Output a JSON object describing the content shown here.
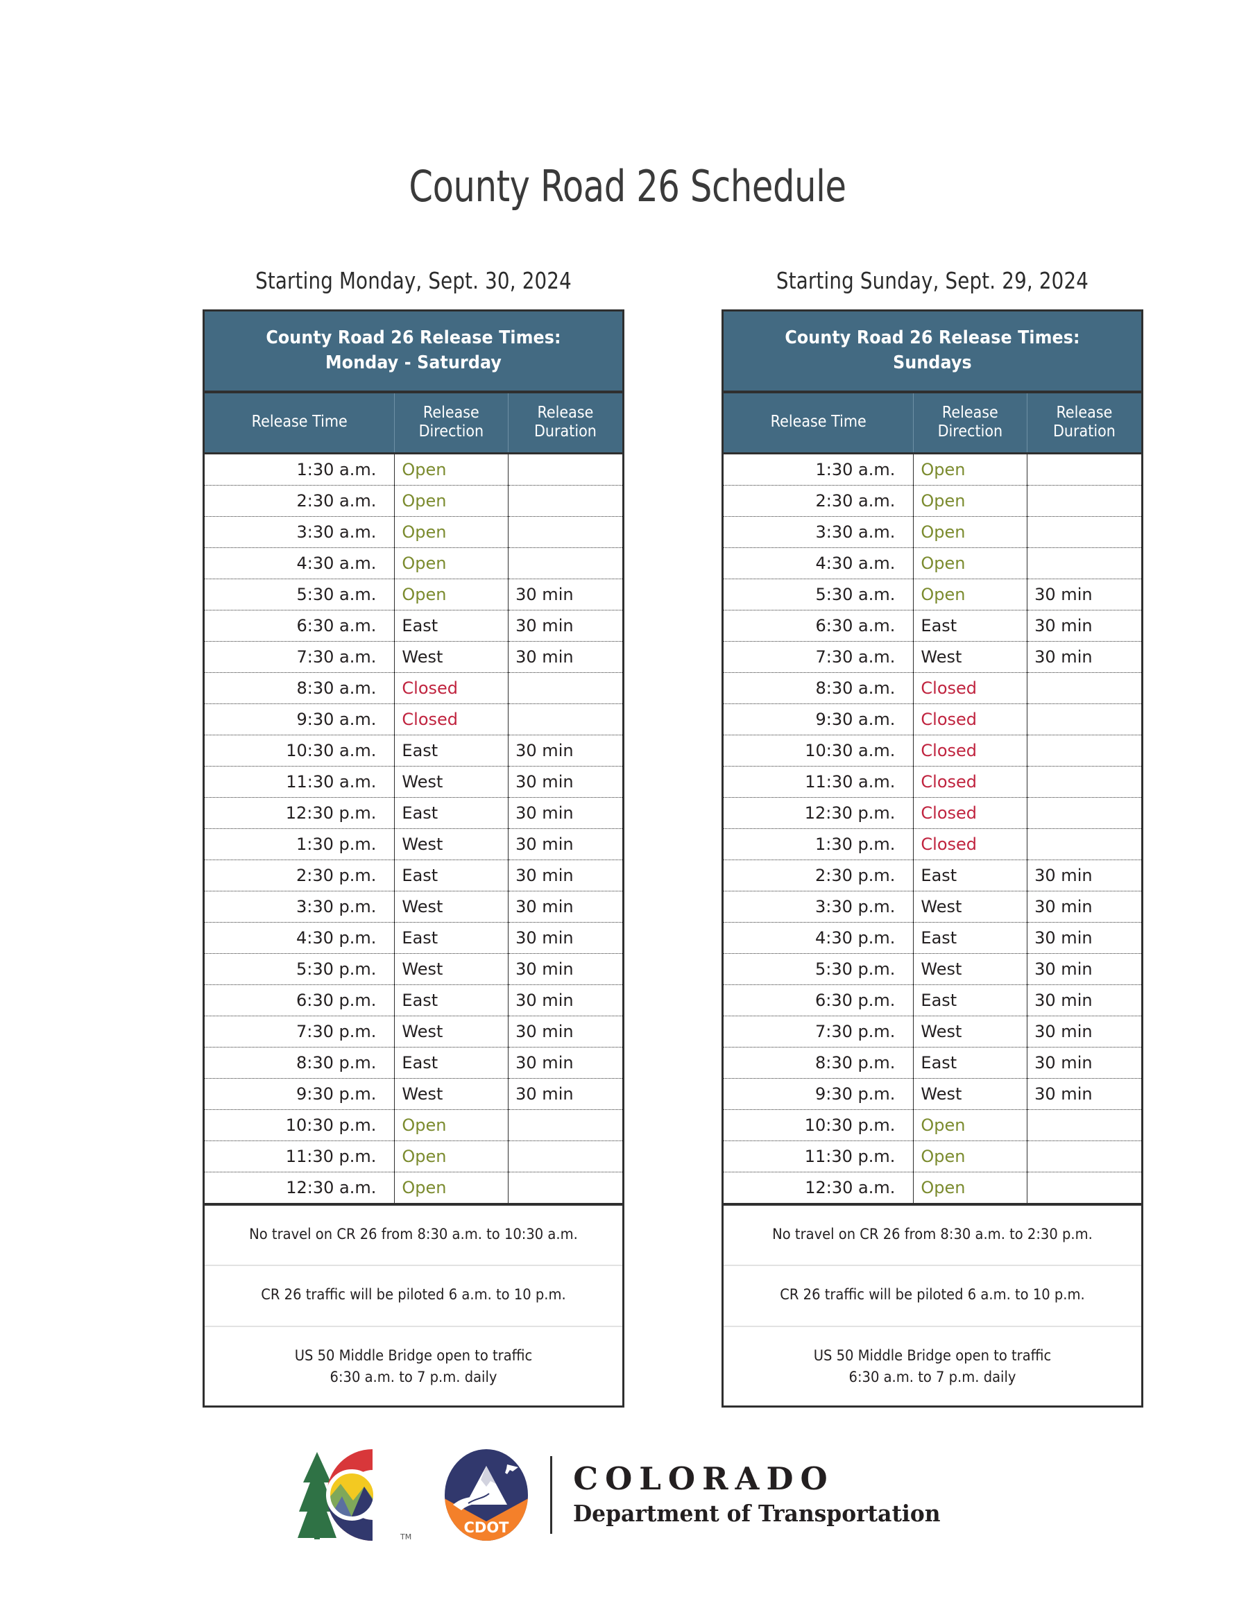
{
  "document": {
    "title": "County Road 26 Schedule"
  },
  "schedules": [
    {
      "caption": "Starting Monday, Sept. 30, 2024",
      "table_title_line1": "County Road 26 Release Times:",
      "table_title_line2": "Monday - Saturday",
      "columns": {
        "time_line1": "Release Time",
        "direction_line1": "Release",
        "direction_line2": "Direction",
        "duration_line1": "Release",
        "duration_line2": "Duration"
      },
      "rows": [
        {
          "time": "1:30 a.m.",
          "direction": "Open",
          "state": "open",
          "duration": ""
        },
        {
          "time": "2:30 a.m.",
          "direction": "Open",
          "state": "open",
          "duration": ""
        },
        {
          "time": "3:30 a.m.",
          "direction": "Open",
          "state": "open",
          "duration": ""
        },
        {
          "time": "4:30 a.m.",
          "direction": "Open",
          "state": "open",
          "duration": ""
        },
        {
          "time": "5:30 a.m.",
          "direction": "Open",
          "state": "open",
          "duration": "30 min"
        },
        {
          "time": "6:30 a.m.",
          "direction": "East",
          "state": "normal",
          "duration": "30 min"
        },
        {
          "time": "7:30 a.m.",
          "direction": "West",
          "state": "normal",
          "duration": "30 min"
        },
        {
          "time": "8:30 a.m.",
          "direction": "Closed",
          "state": "closed",
          "duration": ""
        },
        {
          "time": "9:30 a.m.",
          "direction": "Closed",
          "state": "closed",
          "duration": ""
        },
        {
          "time": "10:30 a.m.",
          "direction": "East",
          "state": "normal",
          "duration": "30 min"
        },
        {
          "time": "11:30 a.m.",
          "direction": "West",
          "state": "normal",
          "duration": "30 min"
        },
        {
          "time": "12:30 p.m.",
          "direction": "East",
          "state": "normal",
          "duration": "30 min"
        },
        {
          "time": "1:30 p.m.",
          "direction": "West",
          "state": "normal",
          "duration": "30 min"
        },
        {
          "time": "2:30 p.m.",
          "direction": "East",
          "state": "normal",
          "duration": "30 min"
        },
        {
          "time": "3:30 p.m.",
          "direction": "West",
          "state": "normal",
          "duration": "30 min"
        },
        {
          "time": "4:30 p.m.",
          "direction": "East",
          "state": "normal",
          "duration": "30 min"
        },
        {
          "time": "5:30 p.m.",
          "direction": "West",
          "state": "normal",
          "duration": "30 min"
        },
        {
          "time": "6:30 p.m.",
          "direction": "East",
          "state": "normal",
          "duration": "30 min"
        },
        {
          "time": "7:30 p.m.",
          "direction": "West",
          "state": "normal",
          "duration": "30 min"
        },
        {
          "time": "8:30 p.m.",
          "direction": "East",
          "state": "normal",
          "duration": "30 min"
        },
        {
          "time": "9:30 p.m.",
          "direction": "West",
          "state": "normal",
          "duration": "30 min"
        },
        {
          "time": "10:30 p.m.",
          "direction": "Open",
          "state": "open",
          "duration": ""
        },
        {
          "time": "11:30 p.m.",
          "direction": "Open",
          "state": "open",
          "duration": ""
        },
        {
          "time": "12:30 a.m.",
          "direction": "Open",
          "state": "open",
          "duration": ""
        }
      ],
      "notes": [
        {
          "lines": [
            "No travel on CR 26 from 8:30 a.m. to 10:30 a.m."
          ]
        },
        {
          "lines": [
            "CR 26 traffic will be piloted 6 a.m. to 10 p.m."
          ]
        },
        {
          "lines": [
            "US 50 Middle Bridge open to traffic",
            "6:30 a.m. to 7 p.m. daily"
          ]
        }
      ]
    },
    {
      "caption": "Starting Sunday, Sept. 29, 2024",
      "table_title_line1": "County Road 26 Release Times:",
      "table_title_line2": "Sundays",
      "columns": {
        "time_line1": "Release Time",
        "direction_line1": "Release",
        "direction_line2": "Direction",
        "duration_line1": "Release",
        "duration_line2": "Duration"
      },
      "rows": [
        {
          "time": "1:30 a.m.",
          "direction": "Open",
          "state": "open",
          "duration": ""
        },
        {
          "time": "2:30 a.m.",
          "direction": "Open",
          "state": "open",
          "duration": ""
        },
        {
          "time": "3:30 a.m.",
          "direction": "Open",
          "state": "open",
          "duration": ""
        },
        {
          "time": "4:30 a.m.",
          "direction": "Open",
          "state": "open",
          "duration": ""
        },
        {
          "time": "5:30 a.m.",
          "direction": "Open",
          "state": "open",
          "duration": "30 min"
        },
        {
          "time": "6:30 a.m.",
          "direction": "East",
          "state": "normal",
          "duration": "30 min"
        },
        {
          "time": "7:30 a.m.",
          "direction": "West",
          "state": "normal",
          "duration": "30 min"
        },
        {
          "time": "8:30 a.m.",
          "direction": "Closed",
          "state": "closed",
          "duration": ""
        },
        {
          "time": "9:30 a.m.",
          "direction": "Closed",
          "state": "closed",
          "duration": ""
        },
        {
          "time": "10:30 a.m.",
          "direction": "Closed",
          "state": "closed",
          "duration": ""
        },
        {
          "time": "11:30 a.m.",
          "direction": "Closed",
          "state": "closed",
          "duration": ""
        },
        {
          "time": "12:30 p.m.",
          "direction": "Closed",
          "state": "closed",
          "duration": ""
        },
        {
          "time": "1:30 p.m.",
          "direction": "Closed",
          "state": "closed",
          "duration": ""
        },
        {
          "time": "2:30 p.m.",
          "direction": "East",
          "state": "normal",
          "duration": "30 min"
        },
        {
          "time": "3:30 p.m.",
          "direction": "West",
          "state": "normal",
          "duration": "30 min"
        },
        {
          "time": "4:30 p.m.",
          "direction": "East",
          "state": "normal",
          "duration": "30 min"
        },
        {
          "time": "5:30 p.m.",
          "direction": "West",
          "state": "normal",
          "duration": "30 min"
        },
        {
          "time": "6:30 p.m.",
          "direction": "East",
          "state": "normal",
          "duration": "30 min"
        },
        {
          "time": "7:30 p.m.",
          "direction": "West",
          "state": "normal",
          "duration": "30 min"
        },
        {
          "time": "8:30 p.m.",
          "direction": "East",
          "state": "normal",
          "duration": "30 min"
        },
        {
          "time": "9:30 p.m.",
          "direction": "West",
          "state": "normal",
          "duration": "30 min"
        },
        {
          "time": "10:30 p.m.",
          "direction": "Open",
          "state": "open",
          "duration": ""
        },
        {
          "time": "11:30 p.m.",
          "direction": "Open",
          "state": "open",
          "duration": ""
        },
        {
          "time": "12:30 a.m.",
          "direction": "Open",
          "state": "open",
          "duration": ""
        }
      ],
      "notes": [
        {
          "lines": [
            "No travel on CR 26 from 8:30 a.m. to 2:30 p.m."
          ]
        },
        {
          "lines": [
            "CR 26 traffic will be piloted 6 a.m. to 10 p.m."
          ]
        },
        {
          "lines": [
            "US 50 Middle Bridge open to traffic",
            "6:30 a.m. to 7 p.m. daily"
          ]
        }
      ]
    }
  ],
  "footer": {
    "agency_line1": "COLORADO",
    "agency_line2": "Department of Transportation",
    "badge_text": "CDOT",
    "trademark": "TM"
  },
  "colors": {
    "header_blue": "#436a82",
    "open_green": "#7b8b2e",
    "closed_red": "#c0243f",
    "border_dark": "#2f2f2f",
    "logo_red": "#d8373a",
    "logo_yellow": "#f3c921",
    "logo_green": "#2f7245",
    "logo_navy": "#31386d",
    "logo_orange": "#f4802a"
  }
}
